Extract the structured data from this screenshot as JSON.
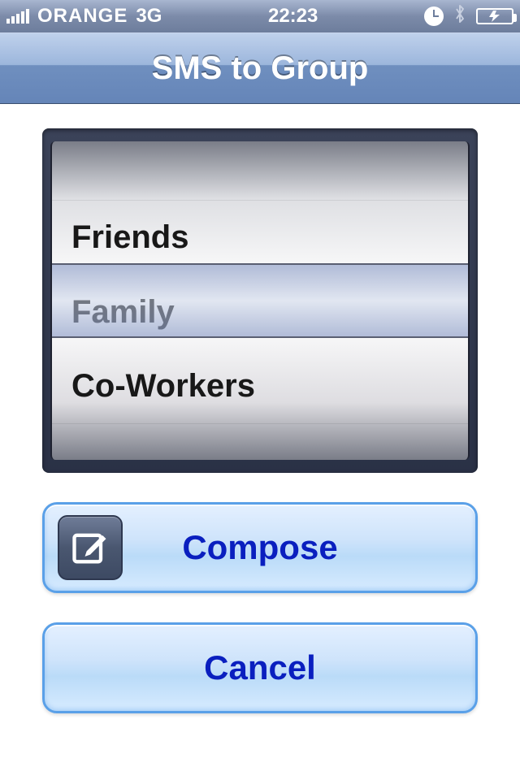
{
  "status": {
    "carrier": "ORANGE",
    "network": "3G",
    "time": "22:23"
  },
  "nav": {
    "title": "SMS to Group"
  },
  "picker": {
    "items": [
      "Friends",
      "Family",
      "Co-Workers"
    ],
    "selected_index": 1
  },
  "buttons": {
    "compose": "Compose",
    "cancel": "Cancel"
  }
}
